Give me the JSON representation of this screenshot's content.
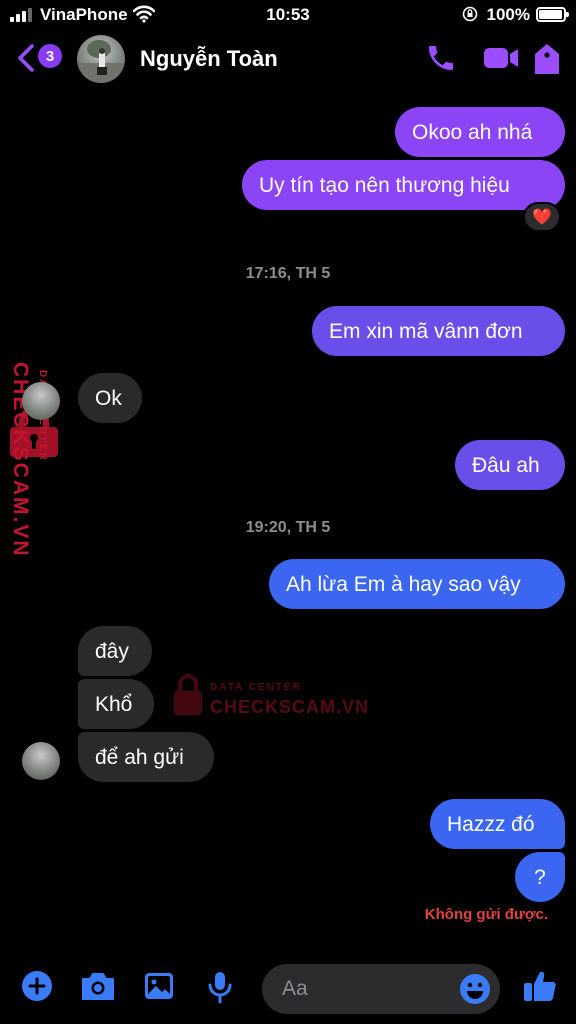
{
  "status_bar": {
    "carrier": "VinaPhone",
    "time": "10:53",
    "battery": "100%"
  },
  "header": {
    "back_badge": "3",
    "contact_name": "Nguyễn Toàn",
    "accent_color": "#9b4dff"
  },
  "messages": [
    {
      "from": "me",
      "text": "Okoo ah nhá"
    },
    {
      "from": "me",
      "text": "Uy tín tạo nên thương hiệu",
      "reaction": "❤️"
    },
    {
      "type": "timestamp",
      "text": "17:16, TH 5"
    },
    {
      "from": "me",
      "text": "Em xin mã vânn đơn"
    },
    {
      "from": "them",
      "text": "Ok"
    },
    {
      "from": "me",
      "text": "Đâu ah"
    },
    {
      "type": "timestamp",
      "text": "19:20, TH 5"
    },
    {
      "from": "me",
      "text": "Ah lừa Em à hay sao vậy"
    },
    {
      "from": "them",
      "text": "đây"
    },
    {
      "from": "them",
      "text": "Khổ"
    },
    {
      "from": "them",
      "text": "để ah gửi"
    },
    {
      "from": "me",
      "text": "Hazzz đó"
    },
    {
      "from": "me",
      "text": "?"
    }
  ],
  "send_error": "Không gửi được.",
  "watermark": {
    "brand": "CHECKSCAM.VN",
    "tagline": "DATA CENTER"
  },
  "composer": {
    "placeholder": "Aa"
  }
}
